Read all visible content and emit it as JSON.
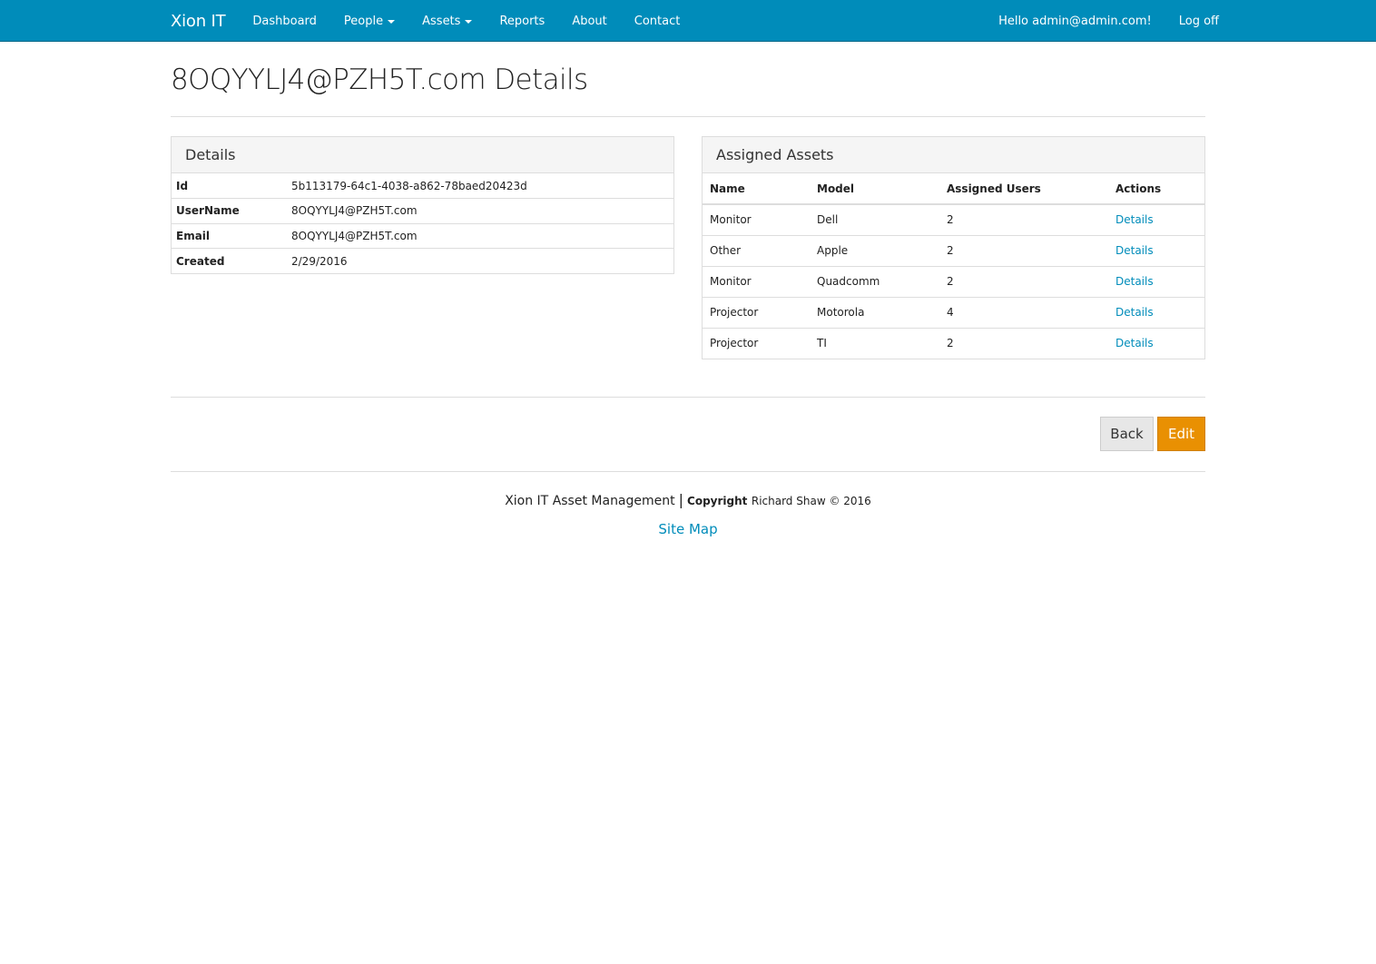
{
  "navbar": {
    "brand": "Xion IT",
    "items": [
      {
        "label": "Dashboard",
        "dropdown": false
      },
      {
        "label": "People",
        "dropdown": true
      },
      {
        "label": "Assets",
        "dropdown": true
      },
      {
        "label": "Reports",
        "dropdown": false
      },
      {
        "label": "About",
        "dropdown": false
      },
      {
        "label": "Contact",
        "dropdown": false
      }
    ],
    "greeting": "Hello admin@admin.com!",
    "logoff": "Log off"
  },
  "page": {
    "title": "8OQYYLJ4@PZH5T.com Details"
  },
  "details_panel": {
    "heading": "Details",
    "rows": [
      {
        "label": "Id",
        "value": "5b113179-64c1-4038-a862-78baed20423d"
      },
      {
        "label": "UserName",
        "value": "8OQYYLJ4@PZH5T.com"
      },
      {
        "label": "Email",
        "value": "8OQYYLJ4@PZH5T.com"
      },
      {
        "label": "Created",
        "value": "2/29/2016"
      }
    ]
  },
  "assets_panel": {
    "heading": "Assigned Assets",
    "columns": [
      "Name",
      "Model",
      "Assigned Users",
      "Actions"
    ],
    "rows": [
      {
        "name": "Monitor",
        "model": "Dell",
        "users": "2",
        "action": "Details"
      },
      {
        "name": "Other",
        "model": "Apple",
        "users": "2",
        "action": "Details"
      },
      {
        "name": "Monitor",
        "model": "Quadcomm",
        "users": "2",
        "action": "Details"
      },
      {
        "name": "Projector",
        "model": "Motorola",
        "users": "4",
        "action": "Details"
      },
      {
        "name": "Projector",
        "model": "TI",
        "users": "2",
        "action": "Details"
      }
    ]
  },
  "buttons": {
    "back": "Back",
    "edit": "Edit"
  },
  "footer": {
    "app_name": "Xion IT Asset Management",
    "separator": "|",
    "copyright_label": "Copyright",
    "copyright_text": "Richard Shaw © 2016",
    "sitemap": "Site Map"
  },
  "colors": {
    "navbar": "#008cba",
    "link": "#008cba",
    "edit_button": "#e99002",
    "back_button": "#e7e7e7"
  }
}
